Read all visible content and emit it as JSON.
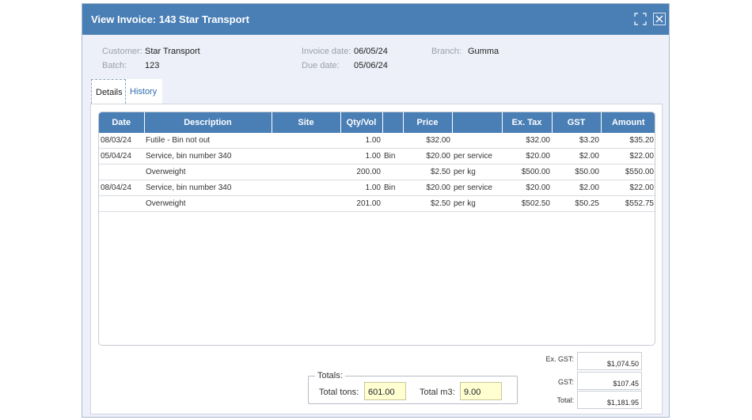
{
  "dialog": {
    "title": "View Invoice: 143 Star Transport",
    "maximize_icon": "expand-icon",
    "close_icon": "close-icon"
  },
  "header": {
    "customer_label": "Customer:",
    "customer_value": "Star Transport",
    "batch_label": "Batch:",
    "batch_value": "123",
    "invoice_date_label": "Invoice date:",
    "invoice_date_value": "06/05/24",
    "due_date_label": "Due date:",
    "due_date_value": "05/06/24",
    "branch_label": "Branch:",
    "branch_value": "Gumma"
  },
  "tabs": [
    {
      "label": "Details",
      "active": true
    },
    {
      "label": "History",
      "active": false
    }
  ],
  "grid": {
    "columns": [
      "Date",
      "Description",
      "Site",
      "Qty/Vol",
      "",
      "Price",
      "",
      "Ex. Tax",
      "GST",
      "Amount"
    ],
    "rows": [
      [
        "08/03/24",
        "Futile - Bin not out",
        "",
        "1.00",
        "",
        "$32.00",
        "",
        "$32.00",
        "$3.20",
        "$35.20"
      ],
      [
        "05/04/24",
        "Service, bin number 340",
        "",
        "1.00",
        "Bin",
        "$20.00",
        "per service",
        "$20.00",
        "$2.00",
        "$22.00"
      ],
      [
        "",
        "Overweight",
        "",
        "200.00",
        "",
        "$2.50",
        "per kg",
        "$500.00",
        "$50.00",
        "$550.00"
      ],
      [
        "08/04/24",
        "Service, bin number 340",
        "",
        "1.00",
        "Bin",
        "$20.00",
        "per service",
        "$20.00",
        "$2.00",
        "$22.00"
      ],
      [
        "",
        "Overweight",
        "",
        "201.00",
        "",
        "$2.50",
        "per kg",
        "$502.50",
        "$50.25",
        "$552.75"
      ]
    ]
  },
  "summary": {
    "ex_gst_label": "Ex. GST:",
    "ex_gst_value": "$1,074.50",
    "gst_label": "GST:",
    "gst_value": "$107.45",
    "total_label": "Total:",
    "total_value": "$1,181.95"
  },
  "totals": {
    "legend": "Totals:",
    "tons_label": "Total tons:",
    "tons_value": "601.00",
    "m3_label": "Total m3:",
    "m3_value": "9.00"
  }
}
